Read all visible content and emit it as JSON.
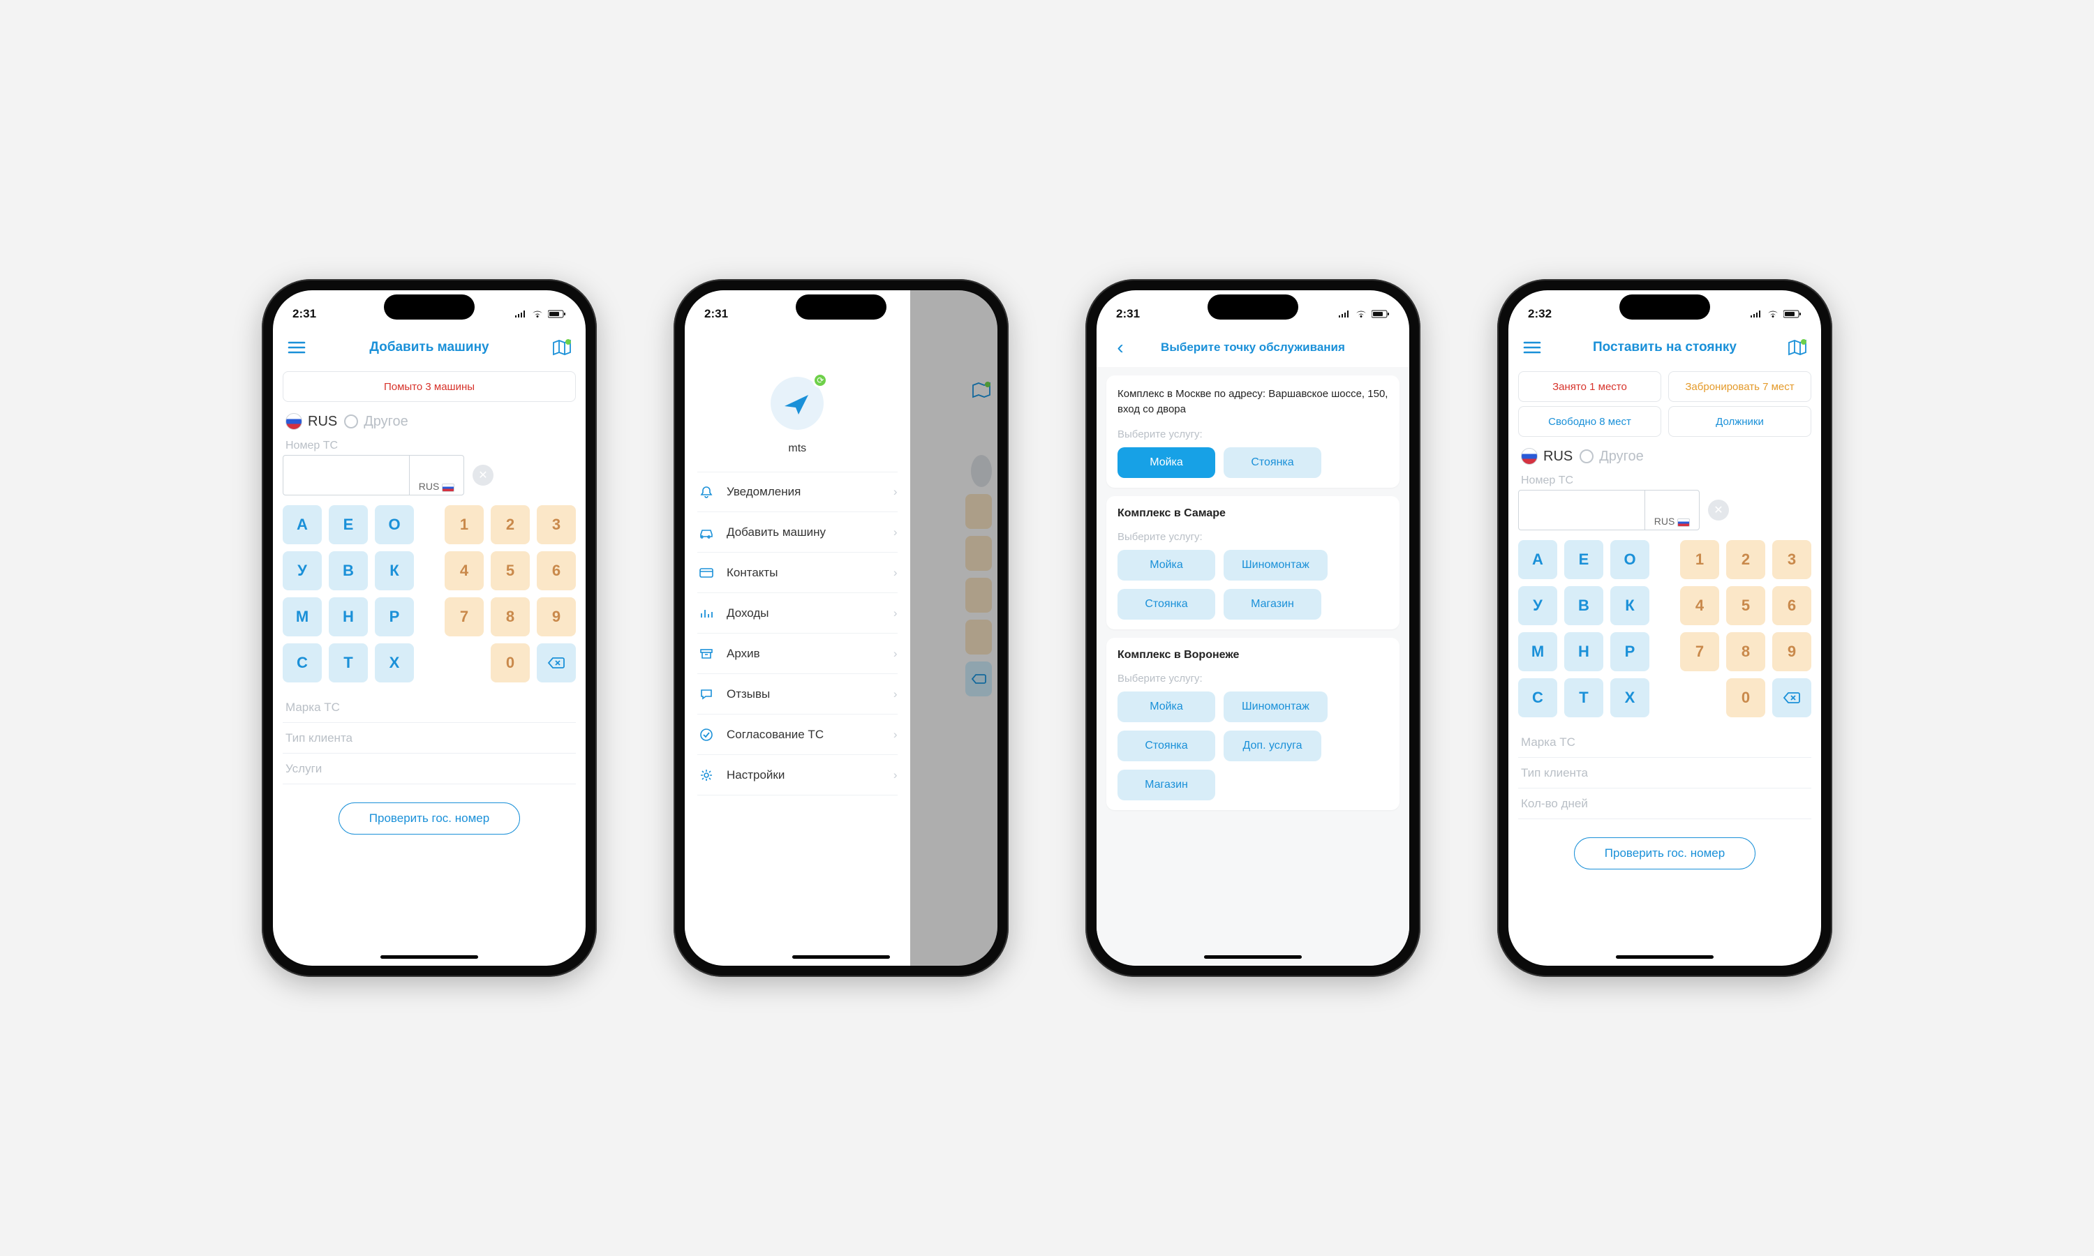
{
  "status": {
    "time_a": "2:31",
    "time_d": "2:32"
  },
  "screen1": {
    "title": "Добавить машину",
    "banner": "Помыто 3 машины",
    "rus": "RUS",
    "other": "Другое",
    "plate_label": "Номер ТС",
    "plate_suffix": "RUS",
    "fields": [
      "Марка ТС",
      "Тип клиента",
      "Услуги"
    ],
    "button": "Проверить гос. номер"
  },
  "keypad": {
    "letters": [
      "А",
      "Е",
      "О",
      "У",
      "В",
      "К",
      "М",
      "Н",
      "Р",
      "С",
      "Т",
      "Х"
    ],
    "nums": [
      "1",
      "2",
      "3",
      "4",
      "5",
      "6",
      "7",
      "8",
      "9"
    ]
  },
  "screen2": {
    "user": "mts",
    "menu": [
      {
        "icon": "bell",
        "label": "Уведомления"
      },
      {
        "icon": "car",
        "label": "Добавить машину"
      },
      {
        "icon": "card",
        "label": "Контакты"
      },
      {
        "icon": "chart",
        "label": "Доходы"
      },
      {
        "icon": "archive",
        "label": "Архив"
      },
      {
        "icon": "chat",
        "label": "Отзывы"
      },
      {
        "icon": "check",
        "label": "Согласование ТС"
      },
      {
        "icon": "gear",
        "label": "Настройки"
      }
    ]
  },
  "screen3": {
    "title": "Выберите точку обслуживания",
    "pick": "Выберите услугу:",
    "c1": {
      "addr": "Комплекс в Москве по адресу: Варшавское шоссе, 150, вход со двора",
      "services": [
        "Мойка",
        "Стоянка"
      ],
      "active": 0
    },
    "c2": {
      "title": "Комплекс в Самаре",
      "services": [
        "Мойка",
        "Шиномонтаж",
        "Стоянка",
        "Магазин"
      ]
    },
    "c3": {
      "title": "Комплекс в Воронеже",
      "services": [
        "Мойка",
        "Шиномонтаж",
        "Стоянка",
        "Доп. услуга",
        "Магазин"
      ]
    }
  },
  "screen4": {
    "title": "Поставить на стоянку",
    "chips": {
      "busy": "Занято 1 место",
      "book": "Забронировать 7 мест",
      "free": "Свободно 8 мест",
      "debt": "Должники"
    },
    "rus": "RUS",
    "other": "Другое",
    "plate_label": "Номер ТС",
    "plate_suffix": "RUS",
    "fields": [
      "Марка ТС",
      "Тип клиента",
      "Кол-во дней"
    ],
    "button": "Проверить гос. номер"
  }
}
